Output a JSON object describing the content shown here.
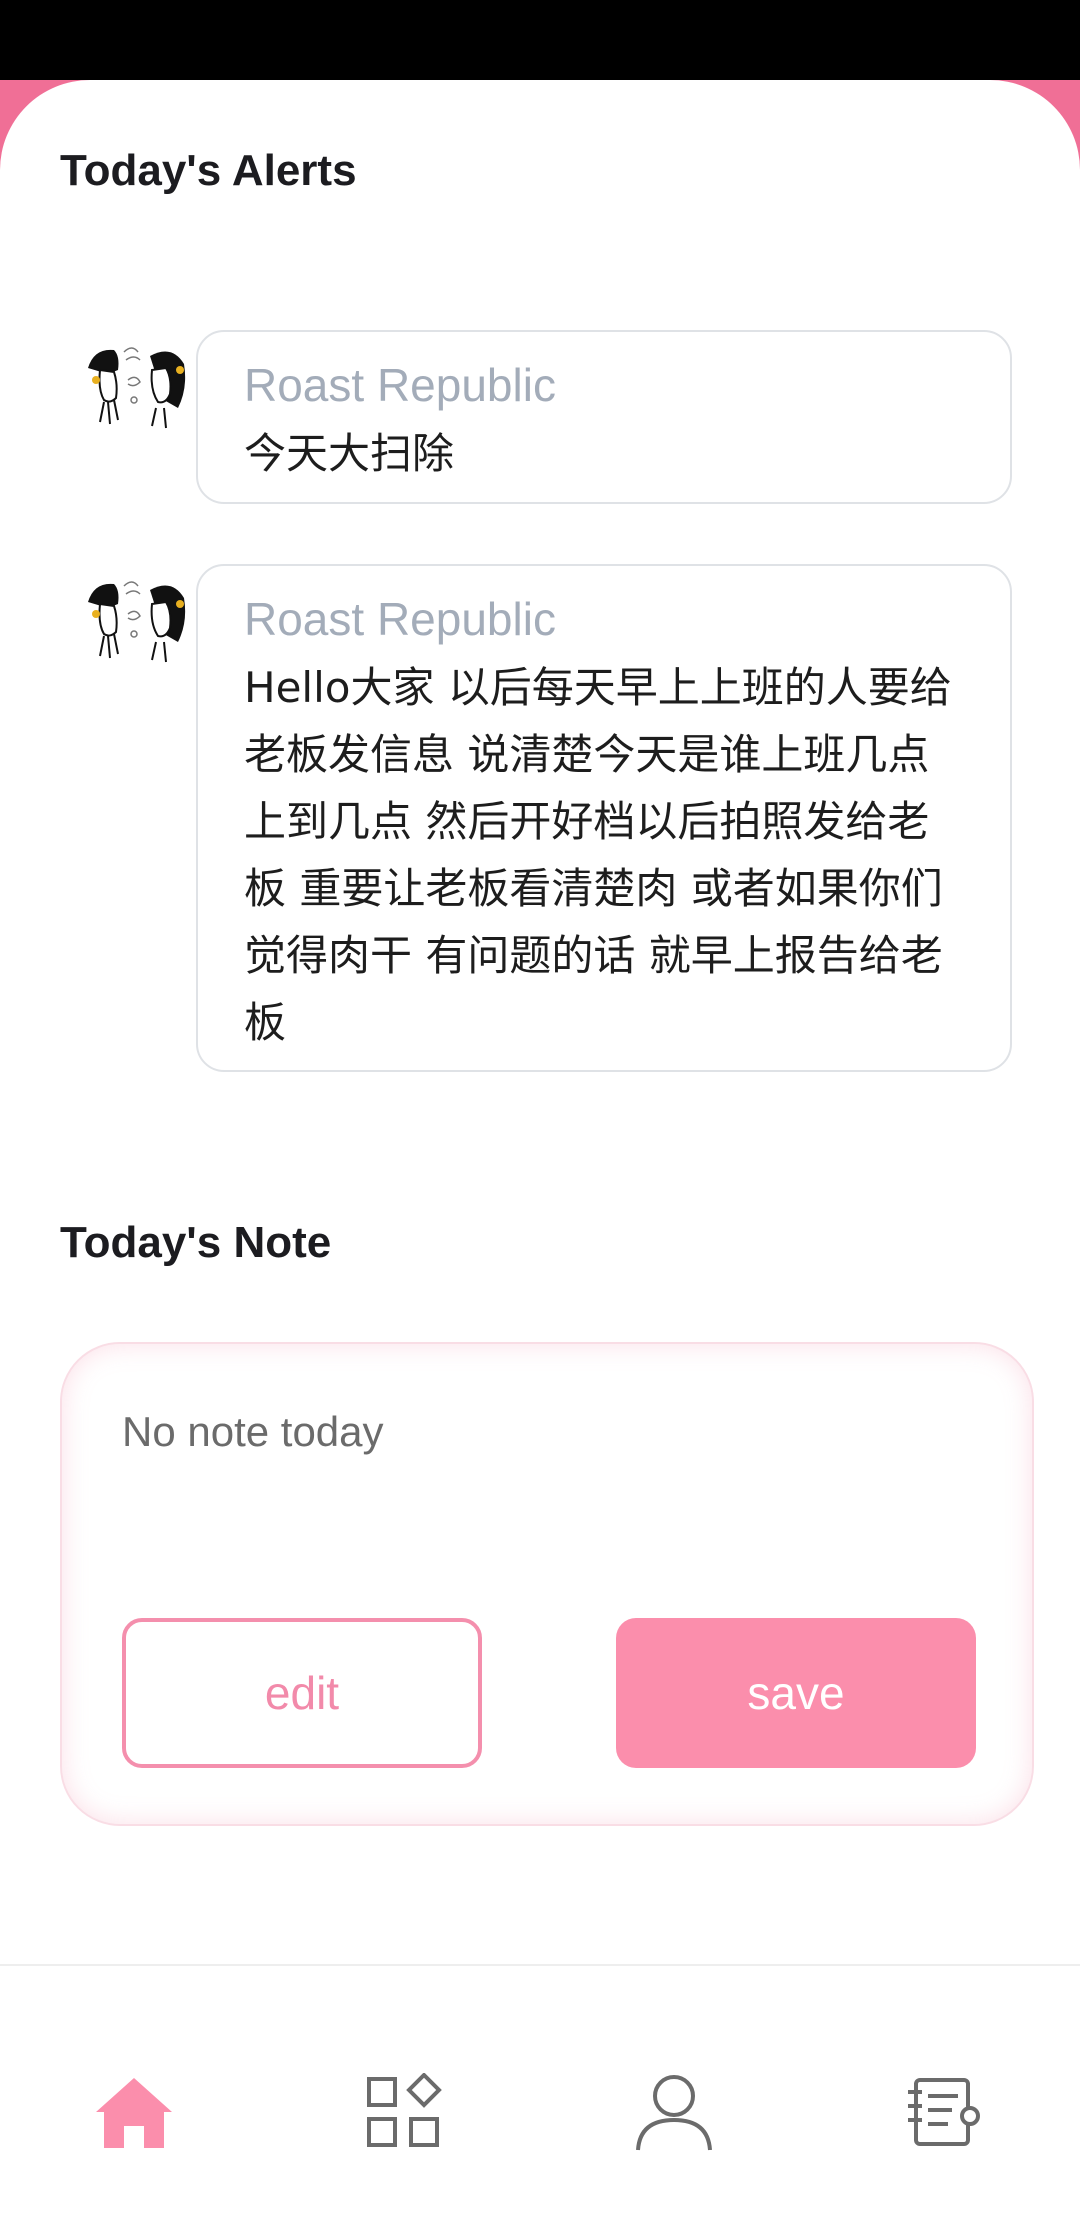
{
  "alerts": {
    "title": "Today's Alerts",
    "items": [
      {
        "sender": "Roast Republic",
        "message": "今天大扫除"
      },
      {
        "sender": "Roast Republic",
        "message": "Hello大家 以后每天早上上班的人要给老板发信息 说清楚今天是谁上班几点上到几点 然后开好档以后拍照发给老板 重要让老板看清楚肉 或者如果你们觉得肉干 有问题的话 就早上报告给老板"
      }
    ]
  },
  "note": {
    "title": "Today's Note",
    "text": "No note today",
    "edit_label": "edit",
    "save_label": "save"
  },
  "nav": {
    "items": [
      {
        "icon": "home-icon",
        "active": true
      },
      {
        "icon": "apps-icon",
        "active": false
      },
      {
        "icon": "profile-icon",
        "active": false
      },
      {
        "icon": "notes-icon",
        "active": false
      }
    ],
    "active_color": "#fb8eac",
    "inactive_color": "#6b6b6b"
  },
  "colors": {
    "accent": "#fb8eac",
    "header_pink": "#f06f96"
  }
}
